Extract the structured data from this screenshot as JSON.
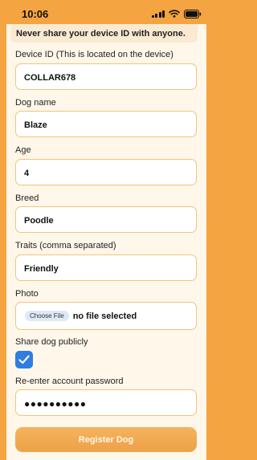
{
  "status_bar": {
    "time": "10:06",
    "icons": [
      "cellular-signal-icon",
      "wifi-icon",
      "battery-icon"
    ]
  },
  "colors": {
    "background": "#f4a441",
    "card": "#fff7e9",
    "input_border": "#f3c37a",
    "checkbox": "#2f7de1",
    "button": "#f0a54c"
  },
  "form": {
    "notice": "Never share your device ID with anyone.",
    "device_id": {
      "label": "Device ID (This is located on the device)",
      "value": "COLLAR678"
    },
    "dog_name": {
      "label": "Dog name",
      "value": "Blaze"
    },
    "age": {
      "label": "Age",
      "value": "4"
    },
    "breed": {
      "label": "Breed",
      "value": "Poodle"
    },
    "traits": {
      "label": "Traits (comma separated)",
      "value": "Friendly"
    },
    "photo": {
      "label": "Photo",
      "button_label": "Choose File",
      "status": "no file selected"
    },
    "share_publicly": {
      "label": "Share dog publicly",
      "checked": true
    },
    "password": {
      "label": "Re-enter account password",
      "value": "●●●●●●●●●●"
    },
    "submit_label": "Register Dog"
  }
}
